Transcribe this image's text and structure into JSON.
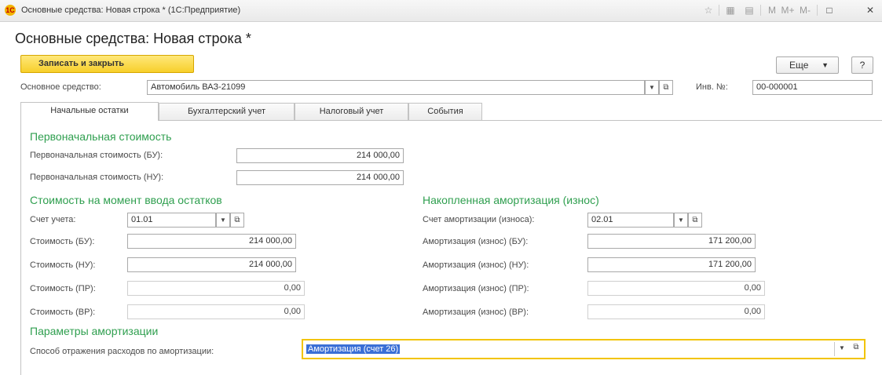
{
  "window": {
    "title": "Основные средства: Новая строка * (1С:Предприятие)",
    "logo": "1С",
    "toolbar_icons": [
      "favorites-icon",
      "table-icon",
      "calendar-icon"
    ],
    "memory_buttons": [
      "M",
      "M+",
      "M-"
    ],
    "maximize_glyph": "□",
    "close_glyph": "✕"
  },
  "form": {
    "title": "Основные средства: Новая строка *",
    "save_close_label": "Записать и закрыть",
    "more_label": "Еще",
    "help_label": "?"
  },
  "asset": {
    "label": "Основное средство:",
    "value": "Автомобиль ВАЗ-21099",
    "inv_label": "Инв. №:",
    "inv_value": "00-000001"
  },
  "tabs": [
    "Начальные остатки",
    "Бухгалтерский учет",
    "Налоговый учет",
    "События"
  ],
  "initial_cost": {
    "heading": "Первоначальная стоимость",
    "bu_label": "Первоначальная стоимость (БУ):",
    "bu_value": "214 000,00",
    "nu_label": "Первоначальная стоимость (НУ):",
    "nu_value": "214 000,00"
  },
  "cost_at_entry": {
    "heading": "Стоимость на момент ввода остатков",
    "account_label": "Счет учета:",
    "account_value": "01.01",
    "rows": [
      {
        "label": "Стоимость (БУ):",
        "value": "214 000,00"
      },
      {
        "label": "Стоимость (НУ):",
        "value": "214 000,00"
      },
      {
        "label": "Стоимость (ПР):",
        "value": "0,00"
      },
      {
        "label": "Стоимость (ВР):",
        "value": "0,00"
      }
    ]
  },
  "depreciation": {
    "heading": "Накопленная амортизация (износ)",
    "account_label": "Счет амортизации (износа):",
    "account_value": "02.01",
    "rows": [
      {
        "label": "Амортизация (износ) (БУ):",
        "value": "171 200,00"
      },
      {
        "label": "Амортизация (износ) (НУ):",
        "value": "171 200,00"
      },
      {
        "label": "Амортизация (износ) (ПР):",
        "value": "0,00"
      },
      {
        "label": "Амортизация (износ) (ВР):",
        "value": "0,00"
      }
    ]
  },
  "params": {
    "heading": "Параметры амортизации",
    "method_label": "Способ отражения расходов по амортизации:",
    "method_value": "Амортизация (счет 26)"
  },
  "colors": {
    "accent_yellow": "#f7cf2b",
    "section_green": "#2f9f4f",
    "selection_blue": "#3a6fd6"
  }
}
